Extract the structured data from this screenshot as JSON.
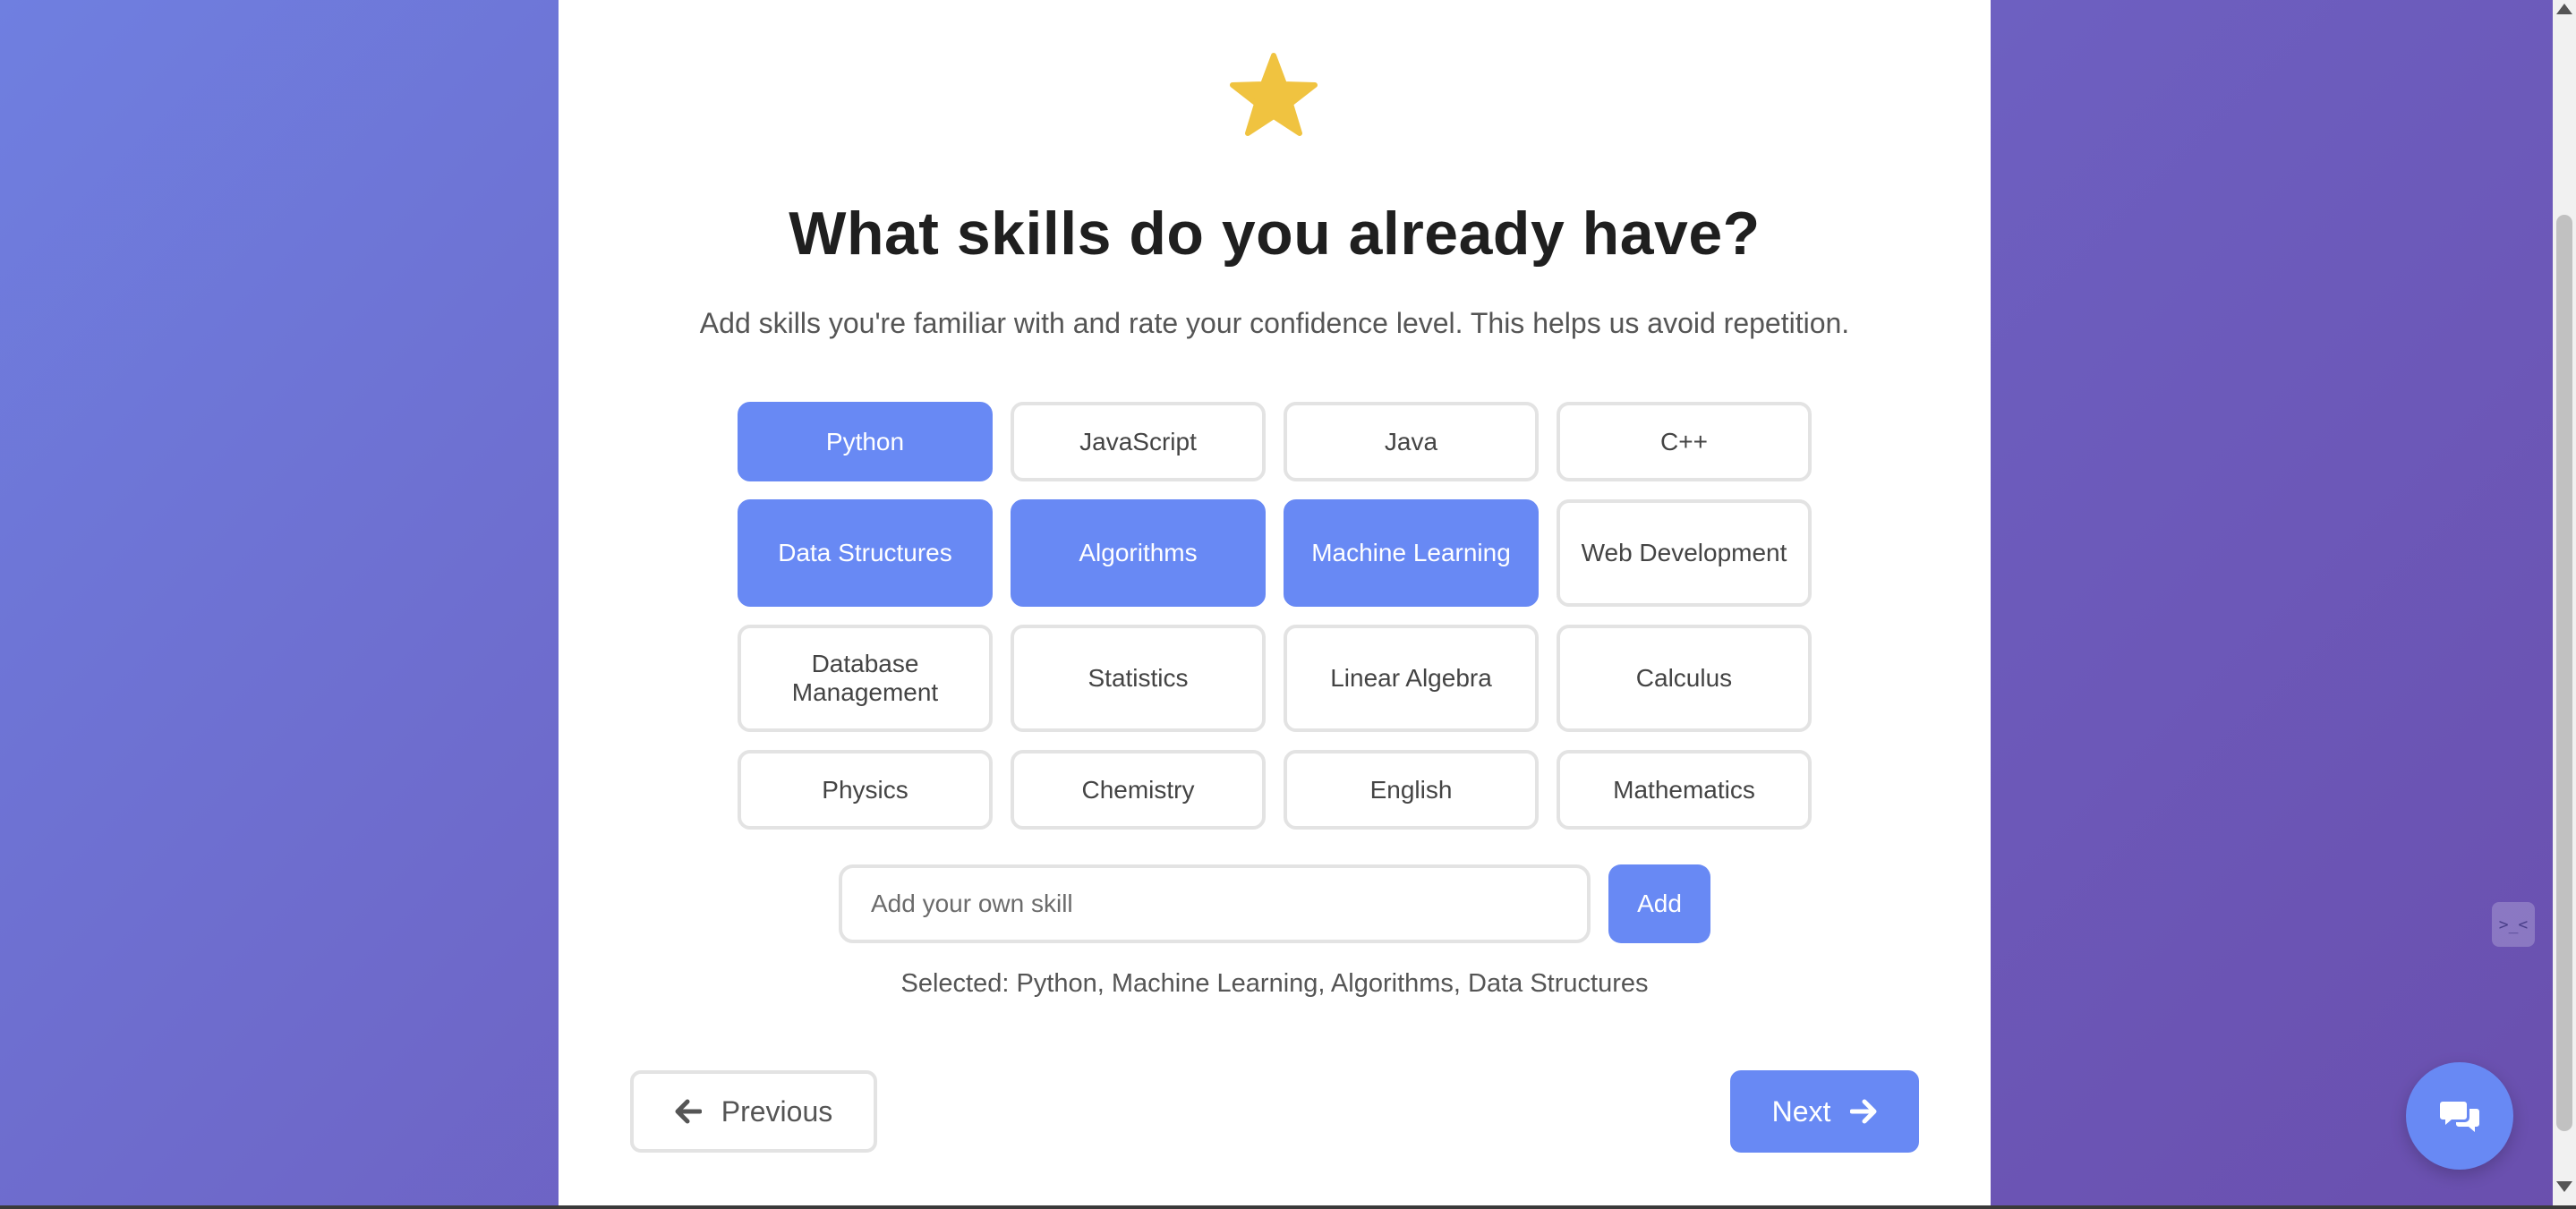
{
  "page": {
    "title": "What skills do you already have?",
    "subtitle": "Add skills you're familiar with and rate your confidence level. This helps us avoid repetition."
  },
  "skills": [
    {
      "label": "Python",
      "selected": true
    },
    {
      "label": "JavaScript",
      "selected": false
    },
    {
      "label": "Java",
      "selected": false
    },
    {
      "label": "C++",
      "selected": false
    },
    {
      "label": "Data Structures",
      "selected": true
    },
    {
      "label": "Algorithms",
      "selected": true
    },
    {
      "label": "Machine Learning",
      "selected": true
    },
    {
      "label": "Web Development",
      "selected": false
    },
    {
      "label": "Database Management",
      "selected": false
    },
    {
      "label": "Statistics",
      "selected": false
    },
    {
      "label": "Linear Algebra",
      "selected": false
    },
    {
      "label": "Calculus",
      "selected": false
    },
    {
      "label": "Physics",
      "selected": false
    },
    {
      "label": "Chemistry",
      "selected": false
    },
    {
      "label": "English",
      "selected": false
    },
    {
      "label": "Mathematics",
      "selected": false
    }
  ],
  "custom_skill": {
    "placeholder": "Add your own skill",
    "value": "",
    "button_label": "Add"
  },
  "selected_summary": "Selected: Python, Machine Learning, Algorithms, Data Structures",
  "nav": {
    "previous_label": "Previous",
    "next_label": "Next"
  },
  "side_tab_label": ">_<",
  "icons": {
    "header": "star-icon",
    "previous": "arrow-left-icon",
    "next": "arrow-right-icon",
    "chat": "chat-bubbles-icon"
  },
  "colors": {
    "accent": "#6889f4",
    "star": "#f0c340",
    "background_start": "#6f7fe0",
    "background_end": "#6a4fae"
  }
}
